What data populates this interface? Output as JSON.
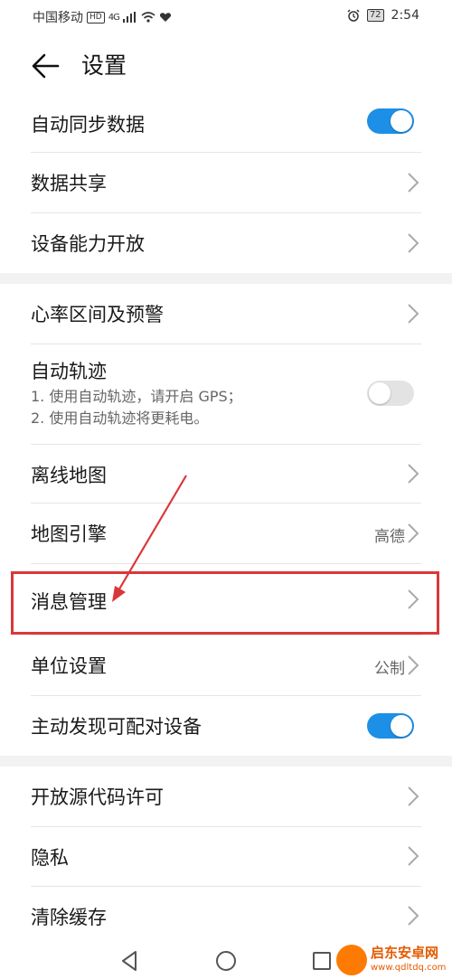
{
  "status_bar": {
    "carrier": "中国移动",
    "hd_badge": "HD",
    "network": "4G",
    "battery": "72",
    "time": "2:54"
  },
  "header": {
    "title": "设置"
  },
  "groups": [
    {
      "items": [
        {
          "label": "自动同步数据",
          "control": "toggle",
          "state": "on"
        },
        {
          "label": "数据共享",
          "control": "chevron"
        },
        {
          "label": "设备能力开放",
          "control": "chevron"
        }
      ]
    },
    {
      "items": [
        {
          "label": "心率区间及预警",
          "control": "chevron"
        },
        {
          "label": "自动轨迹",
          "sub1": "1. 使用自动轨迹，请开启 GPS；",
          "sub2": "2. 使用自动轨迹将更耗电。",
          "control": "toggle",
          "state": "off"
        },
        {
          "label": "离线地图",
          "control": "chevron"
        },
        {
          "label": "地图引擎",
          "value": "高德",
          "control": "chevron"
        },
        {
          "label": "消息管理",
          "control": "chevron"
        },
        {
          "label": "单位设置",
          "value": "公制",
          "control": "chevron"
        },
        {
          "label": "主动发现可配对设备",
          "control": "toggle",
          "state": "on"
        }
      ]
    },
    {
      "items": [
        {
          "label": "开放源代码许可",
          "control": "chevron"
        },
        {
          "label": "隐私",
          "control": "chevron"
        },
        {
          "label": "清除缓存",
          "control": "chevron"
        }
      ]
    }
  ],
  "watermark": {
    "text": "启东安卓网",
    "url": "www.qdltdq.com"
  },
  "colors": {
    "accent": "#1e8fe6",
    "highlight": "#d9383a",
    "toggle_off": "#e3e3e3"
  }
}
